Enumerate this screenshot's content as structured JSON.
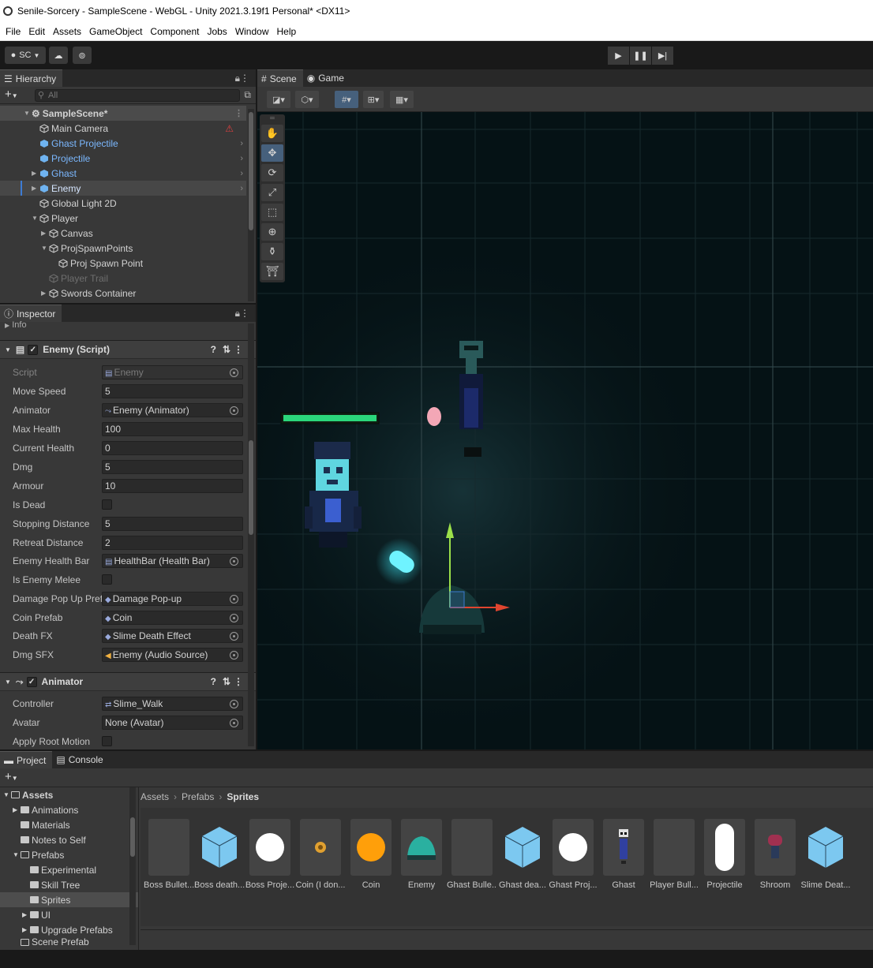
{
  "window": {
    "title": "Senile-Sorcery - SampleScene - WebGL - Unity 2021.3.19f1 Personal* <DX11>"
  },
  "menu": [
    "File",
    "Edit",
    "Assets",
    "GameObject",
    "Component",
    "Jobs",
    "Window",
    "Help"
  ],
  "toolbar": {
    "account_label": "SC",
    "play_icon": "play-icon",
    "pause_icon": "pause-icon",
    "step_icon": "step-icon"
  },
  "hierarchy": {
    "tab": "Hierarchy",
    "search_placeholder": "All",
    "items": [
      {
        "label": "SampleScene*"
      },
      {
        "label": "Main Camera"
      },
      {
        "label": "Ghast Projectile"
      },
      {
        "label": "Projectile"
      },
      {
        "label": "Ghast"
      },
      {
        "label": "Enemy"
      },
      {
        "label": "Global Light 2D"
      },
      {
        "label": "Player"
      },
      {
        "label": "Canvas"
      },
      {
        "label": "ProjSpawnPoints"
      },
      {
        "label": "Proj Spawn Point"
      },
      {
        "label": "Player Trail"
      },
      {
        "label": "Swords Container"
      }
    ]
  },
  "inspector": {
    "tab": "Inspector",
    "info_label": "Info",
    "enemy_component": "Enemy (Script)",
    "props": [
      {
        "label": "Script",
        "value": "Enemy"
      },
      {
        "label": "Move Speed",
        "value": "5"
      },
      {
        "label": "Animator",
        "value": "Enemy (Animator)"
      },
      {
        "label": "Max Health",
        "value": "100"
      },
      {
        "label": "Current Health",
        "value": "0"
      },
      {
        "label": "Dmg",
        "value": "5"
      },
      {
        "label": "Armour",
        "value": "10"
      },
      {
        "label": "Is Dead",
        "value": ""
      },
      {
        "label": "Stopping Distance",
        "value": "5"
      },
      {
        "label": "Retreat Distance",
        "value": "2"
      },
      {
        "label": "Enemy Health Bar",
        "value": "HealthBar (Health Bar)"
      },
      {
        "label": "Is Enemy Melee",
        "value": ""
      },
      {
        "label": "Damage Pop Up Prefab",
        "value": "Damage Pop-up"
      },
      {
        "label": "Coin Prefab",
        "value": "Coin"
      },
      {
        "label": "Death FX",
        "value": "Slime Death Effect"
      },
      {
        "label": "Dmg SFX",
        "value": "Enemy (Audio Source)"
      }
    ],
    "animator_component": "Animator",
    "animator_props": [
      {
        "label": "Controller",
        "value": "Slime_Walk"
      },
      {
        "label": "Avatar",
        "value": "None (Avatar)"
      },
      {
        "label": "Apply Root Motion",
        "value": ""
      }
    ]
  },
  "scene": {
    "tabs": [
      "Scene",
      "Game"
    ]
  },
  "project": {
    "tabs": [
      "Project",
      "Console"
    ],
    "tree": [
      {
        "label": "Assets"
      },
      {
        "label": "Animations"
      },
      {
        "label": "Materials"
      },
      {
        "label": "Notes to Self"
      },
      {
        "label": "Prefabs"
      },
      {
        "label": "Experimental"
      },
      {
        "label": "Skill Tree"
      },
      {
        "label": "Sprites"
      },
      {
        "label": "UI"
      },
      {
        "label": "Upgrade Prefabs"
      },
      {
        "label": "Scene Prefab"
      }
    ],
    "breadcrumb": [
      "Assets",
      "Prefabs",
      "Sprites"
    ],
    "assets": [
      {
        "name": "Boss Bullet...",
        "icon": "empty-thumb"
      },
      {
        "name": "Boss death...",
        "icon": "prefab-cube-icon"
      },
      {
        "name": "Boss Proje...",
        "icon": "white-circle-icon"
      },
      {
        "name": "Coin (I don...",
        "icon": "small-coin-icon"
      },
      {
        "name": "Coin",
        "icon": "orange-circle-icon"
      },
      {
        "name": "Enemy",
        "icon": "slime-icon"
      },
      {
        "name": "Ghast Bulle...",
        "icon": "empty-thumb"
      },
      {
        "name": "Ghast dea...",
        "icon": "prefab-cube-icon"
      },
      {
        "name": "Ghast Proj...",
        "icon": "white-circle-icon"
      },
      {
        "name": "Ghast",
        "icon": "ghast-icon"
      },
      {
        "name": "Player Bull...",
        "icon": "empty-thumb"
      },
      {
        "name": "Projectile",
        "icon": "capsule-icon"
      },
      {
        "name": "Shroom",
        "icon": "shroom-icon"
      },
      {
        "name": "Slime Deat...",
        "icon": "prefab-cube-icon"
      }
    ]
  },
  "colors": {
    "accent": "#46607c",
    "prefab_text": "#7bb8ff",
    "healthbar": "#2bd67b"
  }
}
